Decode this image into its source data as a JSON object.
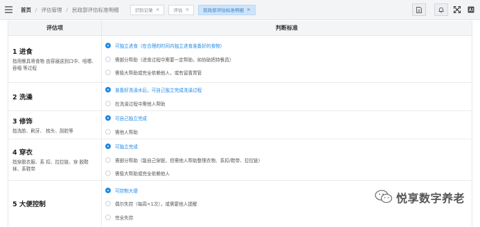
{
  "topbar": {
    "breadcrumb": [
      "首页",
      "评估管理",
      "民政部评估标准明细"
    ],
    "tabs": [
      {
        "label": "识别记录",
        "active": false
      },
      {
        "label": "评估",
        "active": false
      },
      {
        "label": "民政部评估标准明细",
        "active": true
      }
    ],
    "tool_icons": [
      "document-icon",
      "bell-icon",
      "fullscreen-icon",
      "language-icon"
    ]
  },
  "table": {
    "headers": [
      "评估项",
      "判断标准"
    ],
    "rows": [
      {
        "title": "1 进食",
        "desc": "指用餐具将食物 由容器送到口中、咀嚼、吞咽 等过程",
        "options": [
          {
            "text": "可独立进食（在合理的时间内独立进食准备好的食物）",
            "selected": true
          },
          {
            "text": "需部分帮助（进食过程中需要一定帮助，如协助把持餐具）",
            "selected": false
          },
          {
            "text": "需极大帮助或完全依赖他人，或有留置胃管",
            "selected": false
          }
        ]
      },
      {
        "title": "2 洗澡",
        "desc": "",
        "options": [
          {
            "text": "准备好洗澡水后，可自己独立完成洗澡过程",
            "selected": true
          },
          {
            "text": "在洗澡过程中需他人帮助",
            "selected": false
          }
        ]
      },
      {
        "title": "3 修饰",
        "desc": "指洗脸、刷牙、 梳头、刮脸等",
        "options": [
          {
            "text": "可自己独立完成",
            "selected": true
          },
          {
            "text": "需他人帮助",
            "selected": false
          }
        ]
      },
      {
        "title": "4 穿衣",
        "desc": "指穿脱衣服、系 扣、拉拉链、穿 脱鞋袜、系鞋带",
        "options": [
          {
            "text": "可独立完成",
            "selected": true
          },
          {
            "text": "需部分帮助（能自己穿脱，但需他人帮助整理衣物、系扣/鞋带、拉拉链）",
            "selected": false
          },
          {
            "text": "需极大帮助或完全依赖他人",
            "selected": false
          }
        ]
      },
      {
        "title": "5 大便控制",
        "desc": "",
        "options": [
          {
            "text": "可控制大便",
            "selected": true
          },
          {
            "text": "偶尔失控（每周<1次），或需要他人提醒",
            "selected": false
          },
          {
            "text": "完全失控",
            "selected": false
          }
        ]
      }
    ]
  },
  "watermark": {
    "text": "悦享数字养老"
  }
}
